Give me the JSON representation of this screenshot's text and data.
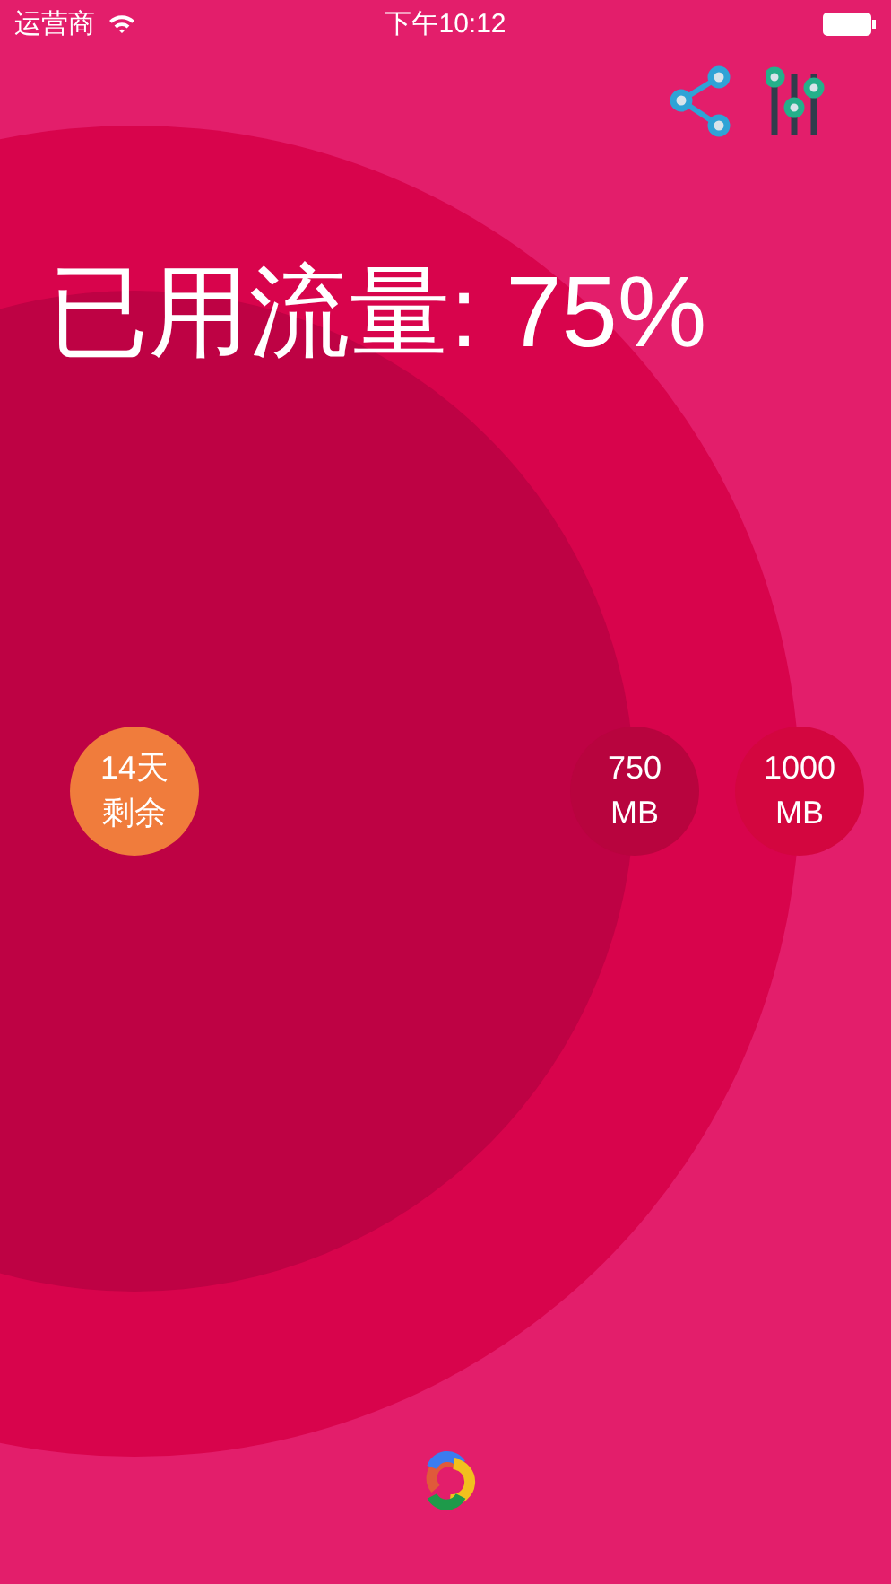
{
  "status_bar": {
    "carrier": "运营商",
    "time": "下午10:12"
  },
  "title": "已用流量: 75%",
  "markers": [
    {
      "kind": "remaining",
      "line1": "14天",
      "line2": "剩余"
    },
    {
      "kind": "used",
      "line1": "750",
      "line2": "MB"
    },
    {
      "kind": "total",
      "line1": "1000",
      "line2": "MB"
    }
  ]
}
